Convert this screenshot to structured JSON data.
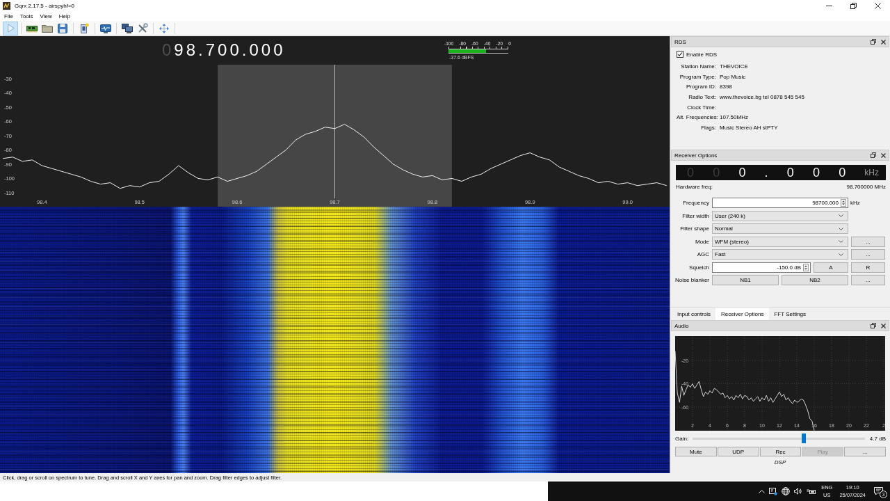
{
  "window": {
    "title": "Gqrx 2.17.5 - airspyhf=0"
  },
  "menu": [
    "File",
    "Tools",
    "View",
    "Help"
  ],
  "toolbar": {
    "start": {
      "kind": "play",
      "checked": true
    },
    "groups": [
      [
        {
          "kind": "device"
        },
        {
          "kind": "open"
        },
        {
          "kind": "save"
        }
      ],
      [
        {
          "kind": "document"
        }
      ],
      [
        {
          "kind": "monitor"
        }
      ],
      [
        {
          "kind": "network"
        },
        {
          "kind": "tools"
        }
      ],
      [
        {
          "kind": "move"
        }
      ]
    ]
  },
  "frequency_display": {
    "dim_digits": "0",
    "digits": "98.700.000"
  },
  "signal_meter": {
    "scale": [
      "-100",
      "-80",
      "-60",
      "-40",
      "-20",
      "0"
    ],
    "level": 0.624,
    "reading": "-37.6 dBFS"
  },
  "spectrum": {
    "chart_data": [
      {
        "type": "line",
        "color": "#f2f2f2",
        "xlim": [
          98.357,
          99.043
        ],
        "ylim": [
          -119.8,
          -20.2
        ],
        "xticks": [
          98.4,
          98.5,
          98.6,
          98.7,
          98.8,
          98.9,
          {
            "value": 99,
            "label": "99.0"
          }
        ],
        "yticks": [
          -30,
          -40,
          -50,
          -60,
          -70,
          -80,
          -90,
          -100,
          -110
        ],
        "bands": [
          {
            "axis": "x",
            "from": 98.58,
            "to": 98.82,
            "color": "#464646"
          }
        ],
        "ref_lines": [
          {
            "axis": "x",
            "value": 98.7,
            "color": "#b8b8b8"
          }
        ],
        "x": [
          98.36,
          98.37,
          98.38,
          98.39,
          98.4,
          98.41,
          98.42,
          98.43,
          98.44,
          98.45,
          98.46,
          98.47,
          98.48,
          98.49,
          98.5,
          98.51,
          98.52,
          98.53,
          98.54,
          98.55,
          98.56,
          98.57,
          98.58,
          98.59,
          98.6,
          98.61,
          98.62,
          98.63,
          98.64,
          98.65,
          98.66,
          98.67,
          98.68,
          98.69,
          98.7,
          98.71,
          98.72,
          98.73,
          98.74,
          98.75,
          98.76,
          98.77,
          98.78,
          98.79,
          98.8,
          98.81,
          98.82,
          98.83,
          98.84,
          98.85,
          98.86,
          98.87,
          98.88,
          98.89,
          98.9,
          98.91,
          98.92,
          98.93,
          98.94,
          98.95,
          98.96,
          98.97,
          98.98,
          98.99,
          99,
          99.01,
          99.02,
          99.03,
          99.04
        ],
        "values": [
          -86,
          -85,
          -88,
          -87,
          -91,
          -93,
          -95,
          -97,
          -99,
          -102,
          -104,
          -103,
          -107,
          -105,
          -106,
          -103,
          -102,
          -97,
          -91,
          -96,
          -100,
          -101,
          -99,
          -102,
          -100,
          -98,
          -95,
          -90,
          -85,
          -80,
          -73,
          -69,
          -67,
          -64,
          -65,
          -62,
          -66,
          -71,
          -78,
          -84,
          -90,
          -94,
          -97,
          -99,
          -98,
          -101,
          -100,
          -102,
          -99,
          -97,
          -93,
          -90,
          -87,
          -84,
          -82,
          -85,
          -87,
          -92,
          -95,
          -98,
          -100,
          -103,
          -102,
          -104,
          -103,
          -105,
          -104,
          -103,
          -105
        ]
      }
    ]
  },
  "rds": {
    "title": "RDS",
    "enable": {
      "label": "Enable RDS",
      "checked": true
    },
    "fields": [
      {
        "label": "Station Name:",
        "value": "THEVOICE"
      },
      {
        "label": "Program Type:",
        "value": "Pop Music"
      },
      {
        "label": "Program ID:",
        "value": "8398"
      },
      {
        "label": "Radio Text:",
        "value": "www.thevoice.bg tel 0878 545 545"
      },
      {
        "label": "Clock Time:"
      },
      {
        "label": "Alt. Frequencies:",
        "value": "107.50MHz"
      },
      {
        "label": "Flags:",
        "value": "Music Stereo AH stPTY"
      }
    ]
  },
  "receiver_options": {
    "title": "Receiver Options",
    "offset_display": {
      "dim_digits": [
        "0",
        "0"
      ],
      "digits": [
        "0",
        ".",
        "0",
        "0",
        "0"
      ],
      "unit": "kHz"
    },
    "hardware_freq": {
      "label": "Hardware freq:",
      "value": "98.700000 MHz"
    },
    "rows": [
      {
        "label": "Frequency",
        "kind": "spinbox",
        "value": "98700.000",
        "unit": "kHz"
      },
      {
        "label": "Filter width",
        "kind": "combo",
        "value": "User (240 k)"
      },
      {
        "label": "Filter shape",
        "kind": "combo",
        "value": "Normal"
      },
      {
        "label": "Mode",
        "kind": "combo",
        "value": "WFM (stereo)",
        "buttons": [
          "..."
        ]
      },
      {
        "label": "AGC",
        "kind": "combo",
        "value": "Fast",
        "buttons": [
          "..."
        ]
      },
      {
        "label": "Squelch",
        "kind": "spinbox",
        "value": "-150.0 dB",
        "buttons": [
          "A",
          "R"
        ]
      },
      {
        "label": "Noise blanker",
        "kind": "buttons",
        "buttons": [
          "NB1",
          "NB2",
          "..."
        ]
      }
    ]
  },
  "tabs": [
    {
      "label": "Input controls",
      "selected": false
    },
    {
      "label": "Receiver Options",
      "selected": true
    },
    {
      "label": "FFT Settings",
      "selected": false
    }
  ],
  "audio": {
    "title": "Audio",
    "fft": {
      "edge_label": "2",
      "chart_data": [
        {
          "type": "line",
          "color": "#e8e8e8",
          "grid": true,
          "xlim": [
            0,
            24.16
          ],
          "ylim": [
            -80.3,
            0.9
          ],
          "xticks": [
            2,
            4,
            6,
            8,
            10,
            12,
            14,
            16,
            18,
            20,
            22
          ],
          "yticks": [
            -20,
            -40,
            -60
          ],
          "x": [
            0,
            0.25,
            0.5,
            0.75,
            1,
            1.25,
            1.5,
            1.75,
            2,
            2.25,
            2.5,
            2.75,
            3,
            3.25,
            3.5,
            3.75,
            4,
            4.25,
            4.5,
            4.75,
            5,
            5.25,
            5.5,
            5.75,
            6,
            6.25,
            6.5,
            6.75,
            7,
            7.25,
            7.5,
            7.75,
            8,
            8.25,
            8.5,
            8.75,
            9,
            9.25,
            9.5,
            9.75,
            10,
            10.25,
            10.5,
            10.75,
            11,
            11.25,
            11.5,
            11.75,
            12,
            12.25,
            12.5,
            12.75,
            13,
            13.25,
            13.5,
            13.75,
            14,
            14.25,
            14.5,
            14.75,
            15,
            15.25,
            15.5,
            15.75,
            16
          ],
          "values": [
            -12,
            -48,
            -56,
            -42,
            -50,
            -45,
            -41,
            -43,
            -40,
            -44,
            -41,
            -38,
            -45,
            -51,
            -47,
            -49,
            -46,
            -48,
            -44,
            -45,
            -47,
            -49,
            -48,
            -52,
            -50,
            -53,
            -51,
            -54,
            -50,
            -52,
            -49,
            -53,
            -50,
            -51,
            -54,
            -52,
            -55,
            -53,
            -51,
            -55,
            -52,
            -54,
            -50,
            -55,
            -52,
            -56,
            -53,
            -50,
            -47,
            -51,
            -49,
            -54,
            -52,
            -55,
            -57,
            -54,
            -56,
            -55,
            -53,
            -54,
            -58,
            -63,
            -70,
            -72,
            -80
          ]
        }
      ]
    },
    "gain": {
      "label": "Gain:",
      "level": 0.645,
      "reading": "4.7 dB"
    },
    "buttons": [
      {
        "label": "Mute",
        "disabled": false
      },
      {
        "label": "UDP",
        "disabled": false
      },
      {
        "label": "Rec",
        "disabled": false
      },
      {
        "label": "Play",
        "disabled": true
      },
      {
        "label": "...",
        "disabled": false
      }
    ],
    "dsp_label": "DSP"
  },
  "status_bar": "Click, drag or scroll on spectrum to tune. Drag and scroll X and Y axes for pan and zoom. Drag filter edges to adjust filter.",
  "taskbar": {
    "language": "ENG",
    "region": "US",
    "time": "19:10",
    "date": "25/07/2024",
    "notifications": "3"
  }
}
